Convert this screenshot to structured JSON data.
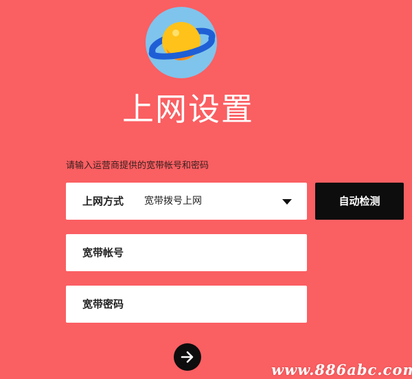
{
  "page": {
    "title": "上网设置",
    "hint": "请输入运营商提供的宽带帐号和密码"
  },
  "form": {
    "wan_mode": {
      "label": "上网方式",
      "selected": "宽带拨号上网"
    },
    "account": {
      "label": "宽带帐号",
      "value": ""
    },
    "password": {
      "label": "宽带密码",
      "value": ""
    }
  },
  "buttons": {
    "detect_label": "自动检测",
    "next_icon": "arrow-right-icon"
  },
  "logo": {
    "icon": "planet-icon"
  },
  "watermark": "www.886abc.com",
  "colors": {
    "background": "#fa5f62",
    "field_bg": "#ffffff",
    "button_bg": "#0d0d0d",
    "logo_circle": "#7fc4ec",
    "planet_yellow": "#ffc21a",
    "planet_orange": "#ff8a1e",
    "ring_blue": "#1f5fd6"
  }
}
